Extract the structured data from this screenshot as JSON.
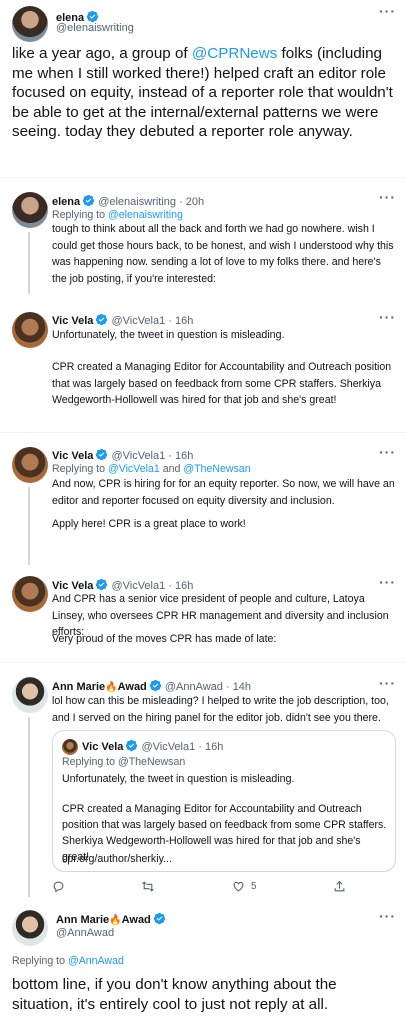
{
  "main_tweet": {
    "name": "elena",
    "handle": "@elenaiswriting",
    "text_plain_1": "like a year ago, a group of ",
    "mention": "@CPRNews",
    "text_plain_2": " folks (including me when I still worked there!) helped craft an editor role focused on equity, instead of a reporter role that wouldn't be able to get at the internal/external patterns we were seeing. today they debuted a reporter role anyway."
  },
  "replies": [
    {
      "name": "elena",
      "handle": "@elenaiswriting",
      "time": "· 20h",
      "replying_prefix": "Replying to ",
      "replying_to": "@elenaiswriting",
      "text": "tough to think about all the back and forth we had go nowhere. wish I could get those hours back, to be honest, and wish I understood why this was happening now. sending a lot of love to my folks there. and here's the job posting, if you're interested:"
    },
    {
      "name": "Vic Vela",
      "handle": "@VicVela1",
      "time": "· 16h",
      "text_p1": "Unfortunately, the tweet in question is misleading.",
      "text_p2": "CPR created a Managing Editor for Accountability and Outreach position that was largely based on feedback from some CPR staffers. Sherkiya Wedgeworth-Hollowell was hired for that job and she's great!"
    },
    {
      "name": "Vic Vela",
      "handle": "@VicVela1",
      "time": "· 16h",
      "replying_prefix": "Replying to ",
      "replying_to_1": "@VicVela1",
      "replying_and": " and ",
      "replying_to_2": "@TheNewsan",
      "text_p1": "And now, CPR is hiring for for an equity reporter. So now, we will have an editor and reporter focused on equity diversity and inclusion.",
      "text_p2": "Apply here! CPR is a great place to work!"
    },
    {
      "name": "Vic Vela",
      "handle": "@VicVela1",
      "time": "· 16h",
      "text_p1": "And CPR has a senior vice president of people and culture, Latoya Linsey, who oversees CPR HR management and diversity and inclusion efforts:",
      "text_p2": "Very proud of the moves CPR has made of late:"
    },
    {
      "name": "Ann Marie",
      "name_emoji": "🔥",
      "name_2": "Awad",
      "handle": "@AnnAwad",
      "time": "· 14h",
      "text": "lol how can this be misleading? I helped to write the job description, too, and I served on the hiring panel for the editor job. didn't see you there.",
      "quote": {
        "name": "Vic Vela",
        "handle": "@VicVela1",
        "time": "· 16h",
        "replying": "Replying to @TheNewsan",
        "text_p1": "Unfortunately, the tweet in question is misleading.",
        "text_p2": "CPR created a Managing Editor for Accountability and Outreach position that was largely based on feedback from some CPR staffers. Sherkiya Wedgeworth-Hollowell was hired for that job and she's great!",
        "link": "cpr.org/author/sherkiy..."
      },
      "like_count": "5"
    }
  ],
  "final_tweet": {
    "name": "Ann Marie",
    "name_emoji": "🔥",
    "name_2": "Awad",
    "handle": "@AnnAwad",
    "replying_prefix": "Replying to ",
    "replying_to": "@AnnAwad",
    "text": "bottom line, if you don't know anything about the situation, it's entirely cool to just not reply at all."
  },
  "icons": {
    "more": "more-dots-icon",
    "verified": "verified-badge-icon",
    "reply": "reply-icon",
    "retweet": "retweet-icon",
    "like": "like-icon",
    "share": "share-icon"
  },
  "colors": {
    "accent": "#1d9bf0",
    "text": "#0f1419",
    "muted": "#536471",
    "border": "#cfd9de"
  }
}
